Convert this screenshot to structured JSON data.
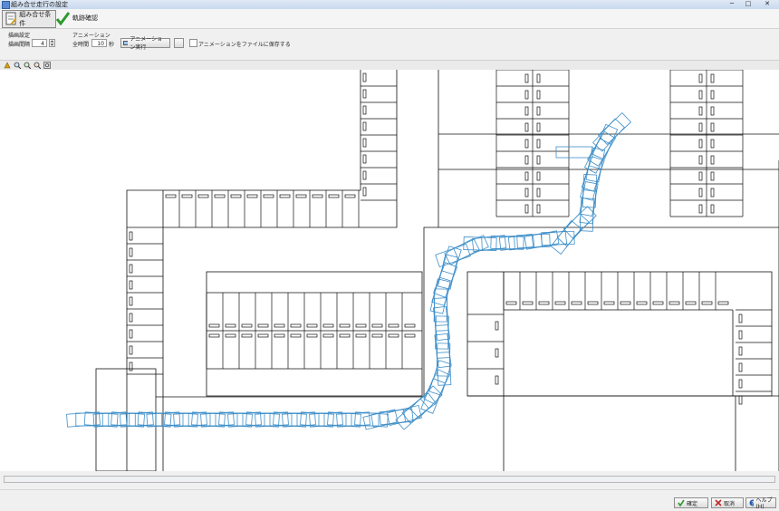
{
  "window": {
    "title": "組み合せ走行の設定",
    "min": "─",
    "max": "□",
    "close": "✕"
  },
  "toolbar": {
    "tab_conditions": "組み合せ条件",
    "tab_check": "軌跡確認"
  },
  "drawing": {
    "header": "描画設定",
    "interval_label": "描画間隔",
    "interval_value": "4"
  },
  "animation": {
    "header": "アニメーション",
    "total_time_label": "全時間",
    "total_time_value": "10",
    "unit": "秒",
    "run_label": "アニメーション実行",
    "save_label": "アニメーションをファイルに保存する"
  },
  "footer": {
    "ok_label": "確定",
    "cancel_label": "取消",
    "help_label": "ヘルプ(H)"
  },
  "colors": {
    "accent": "#3d8fd1",
    "trajectory": "#3e8fc9",
    "check_green": "#2c9a2c",
    "cancel_red": "#c0282a",
    "help_blue": "#2860b0"
  }
}
